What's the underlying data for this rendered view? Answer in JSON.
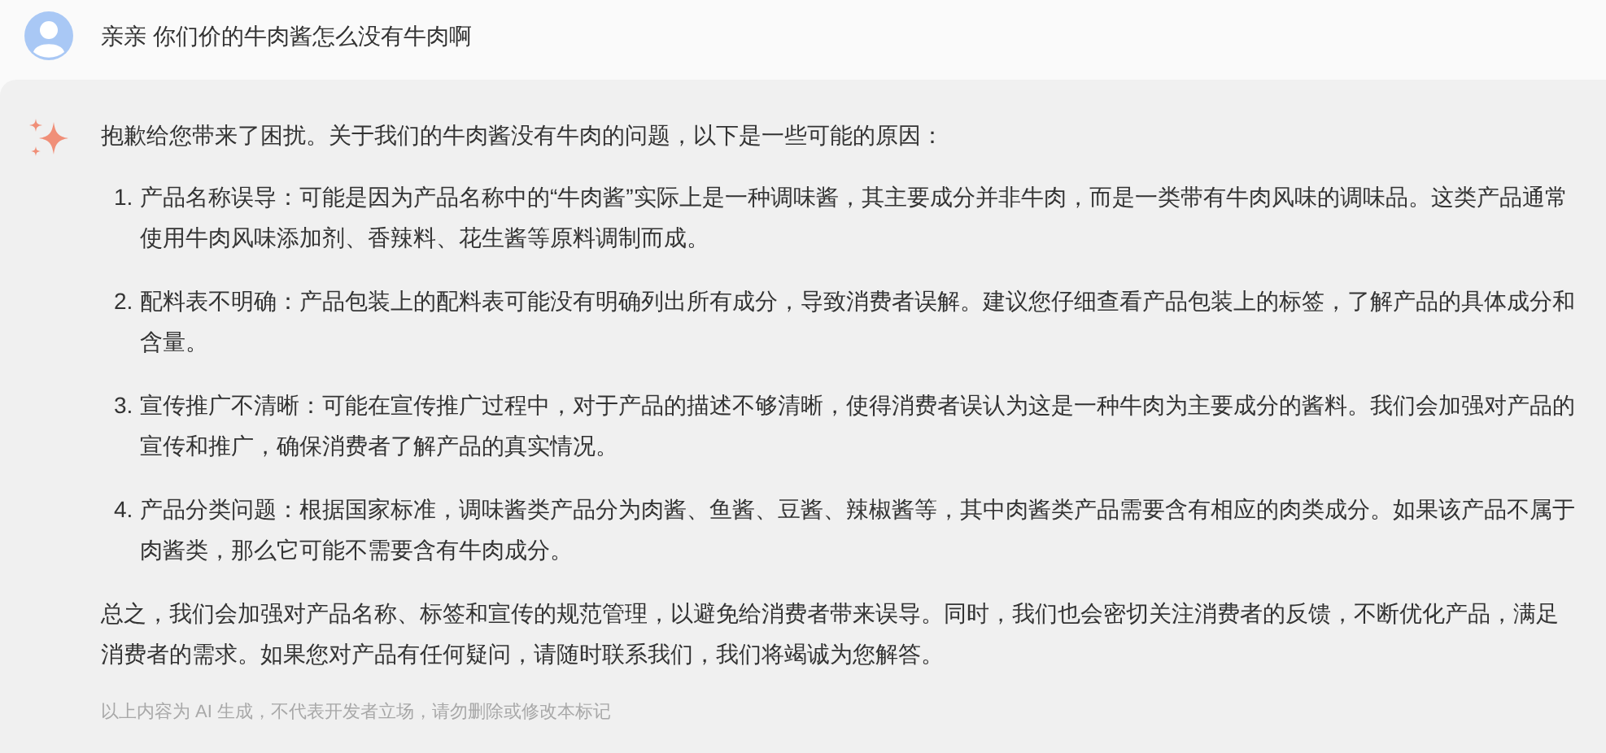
{
  "user_message": {
    "text": "亲亲 你们价的牛肉酱怎么没有牛肉啊"
  },
  "ai_reply": {
    "intro": "抱歉给您带来了困扰。关于我们的牛肉酱没有牛肉的问题，以下是一些可能的原因：",
    "items": [
      {
        "number": "1.",
        "text": "产品名称误导：可能是因为产品名称中的“牛肉酱”实际上是一种调味酱，其主要成分并非牛肉，而是一类带有牛肉风味的调味品。这类产品通常使用牛肉风味添加剂、香辣料、花生酱等原料调制而成。"
      },
      {
        "number": "2.",
        "text": "配料表不明确：产品包装上的配料表可能没有明确列出所有成分，导致消费者误解。建议您仔细查看产品包装上的标签，了解产品的具体成分和含量。"
      },
      {
        "number": "3.",
        "text": "宣传推广不清晰：可能在宣传推广过程中，对于产品的描述不够清晰，使得消费者误认为这是一种牛肉为主要成分的酱料。我们会加强对产品的宣传和推广，确保消费者了解产品的真实情况。"
      },
      {
        "number": "4.",
        "text": "产品分类问题：根据国家标准，调味酱类产品分为肉酱、鱼酱、豆酱、辣椒酱等，其中肉酱类产品需要含有相应的肉类成分。如果该产品不属于肉酱类，那么它可能不需要含有牛肉成分。"
      }
    ],
    "summary": "总之，我们会加强对产品名称、标签和宣传的规范管理，以避免给消费者带来误导。同时，我们也会密切关注消费者的反馈，不断优化产品，满足消费者的需求。如果您对产品有任何疑问，请随时联系我们，我们将竭诚为您解答。",
    "disclaimer": "以上内容为 AI 生成，不代表开发者立场，请勿删除或修改本标记"
  }
}
